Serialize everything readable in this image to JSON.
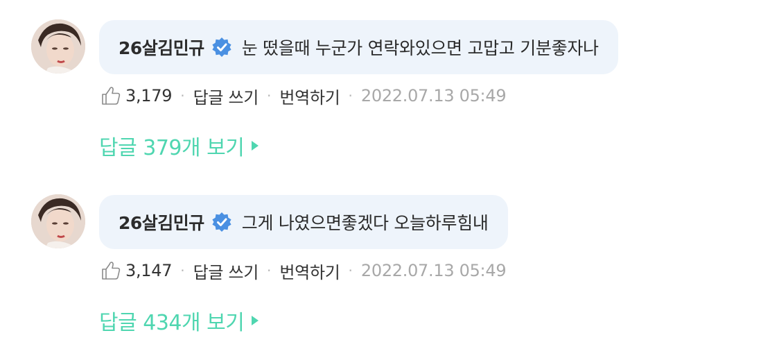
{
  "comments": [
    {
      "author": "26살김민규",
      "text": "눈 떴을때 누군가 연락와있으면 고맙고 기분좋자나",
      "likes": "3,179",
      "reply_label": "답글 쓰기",
      "translate_label": "번역하기",
      "date": "2022.07.13 05:49",
      "view_replies": "답글 379개 보기"
    },
    {
      "author": "26살김민규",
      "text": "그게 나였으면좋겠다 오늘하루힘내",
      "likes": "3,147",
      "reply_label": "답글 쓰기",
      "translate_label": "번역하기",
      "date": "2022.07.13 05:49",
      "view_replies": "답글 434개 보기"
    }
  ],
  "colors": {
    "bubble": "#eef4fb",
    "verified": "#4a90e2",
    "accent": "#4fd6b0",
    "muted": "#a8a8a8"
  },
  "icons": {
    "verified": "verified-badge-icon",
    "like": "thumbs-up-icon",
    "expand": "caret-right-icon"
  }
}
